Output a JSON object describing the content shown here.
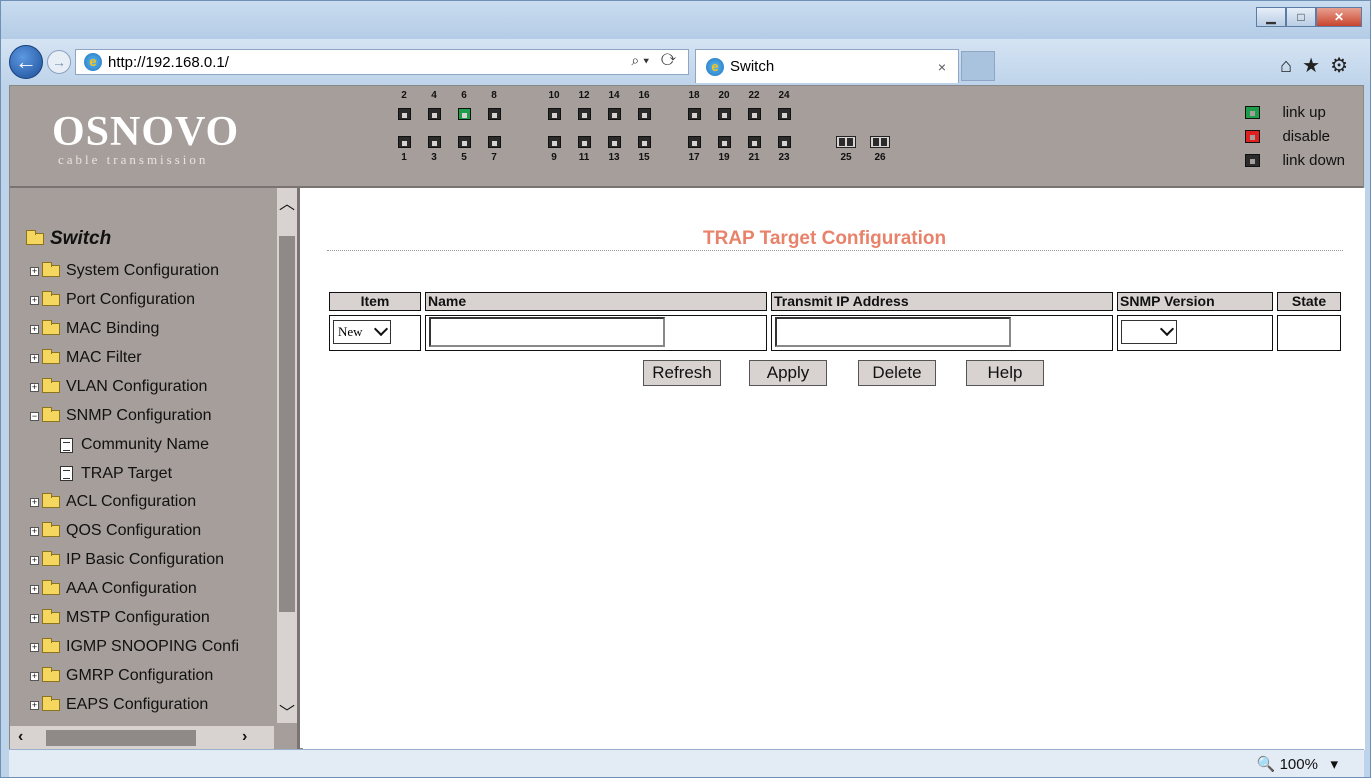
{
  "browser": {
    "url": "http://192.168.0.1/",
    "tab_title": "Switch",
    "tab_close": "×",
    "window_controls": [
      "minimize",
      "maximize",
      "close"
    ],
    "toolbar_icons": [
      "home-icon",
      "favorites-star-icon",
      "settings-gear-icon"
    ]
  },
  "banner": {
    "logo": "OSNOVO",
    "logo_sub": "cable transmission",
    "top_ports": [
      "2",
      "4",
      "6",
      "8",
      "10",
      "12",
      "14",
      "16",
      "18",
      "20",
      "22",
      "24"
    ],
    "bottom_ports": [
      "1",
      "3",
      "5",
      "7",
      "9",
      "11",
      "13",
      "15",
      "17",
      "19",
      "21",
      "23"
    ],
    "sfp_ports": [
      "25",
      "26"
    ],
    "link_up_port": "6",
    "legend": [
      {
        "label": "link up",
        "color": "#1e9e4a"
      },
      {
        "label": "disable",
        "color": "#e02020"
      },
      {
        "label": "link down",
        "color": "#2b2b2b"
      }
    ]
  },
  "sidebar": {
    "root": "Switch",
    "items": [
      {
        "label": "System Configuration"
      },
      {
        "label": "Port Configuration"
      },
      {
        "label": "MAC Binding"
      },
      {
        "label": "MAC Filter"
      },
      {
        "label": "VLAN Configuration"
      },
      {
        "label": "SNMP Configuration",
        "expanded": true
      },
      {
        "label": "Community Name",
        "child": true
      },
      {
        "label": "TRAP Target",
        "child": true,
        "selected": true
      },
      {
        "label": "ACL Configuration"
      },
      {
        "label": "QOS Configuration"
      },
      {
        "label": "IP Basic Configuration"
      },
      {
        "label": "AAA Configuration"
      },
      {
        "label": "MSTP Configuration"
      },
      {
        "label": "IGMP SNOOPING Confi"
      },
      {
        "label": "GMRP Configuration"
      },
      {
        "label": "EAPS Configuration"
      }
    ]
  },
  "main": {
    "title": "TRAP Target Configuration",
    "columns": [
      "Item",
      "Name",
      "Transmit IP Address",
      "SNMP Version",
      "State"
    ],
    "row": {
      "item_select": "New",
      "name": "",
      "transmit_ip": "",
      "snmp_version": "",
      "state": ""
    },
    "buttons": [
      "Refresh",
      "Apply",
      "Delete",
      "Help"
    ]
  },
  "status": {
    "zoom": "100%"
  }
}
